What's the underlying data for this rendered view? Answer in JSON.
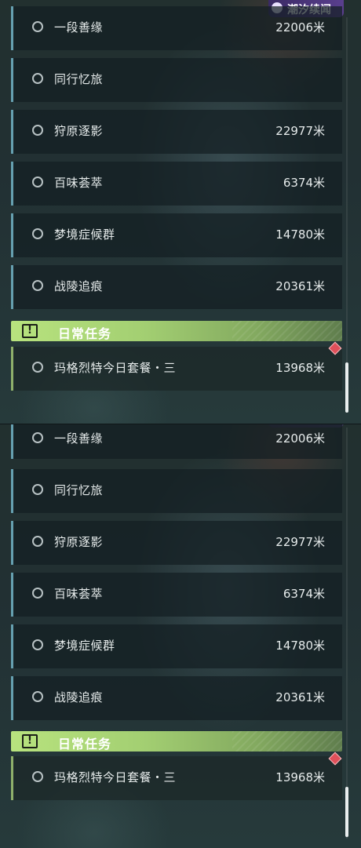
{
  "logo_text": "潮汐续闻",
  "tasks": [
    {
      "name": "一段善缘",
      "distance": "22006米"
    },
    {
      "name": "同行忆旅",
      "distance": ""
    },
    {
      "name": "狩原逐影",
      "distance": "22977米"
    },
    {
      "name": "百味荟萃",
      "distance": "6374米"
    },
    {
      "name": "梦境症候群",
      "distance": "14780米"
    },
    {
      "name": "战陵追痕",
      "distance": "20361米"
    }
  ],
  "daily_section": {
    "title": "日常任务",
    "icon": "exclamation-icon",
    "task": {
      "name": "玛格烈特今日套餐・三",
      "distance": "13968米"
    }
  },
  "colors": {
    "accent_green": "#b8e37e",
    "item_border_blue": "#66a0b0",
    "alert_red": "#e0505a"
  }
}
